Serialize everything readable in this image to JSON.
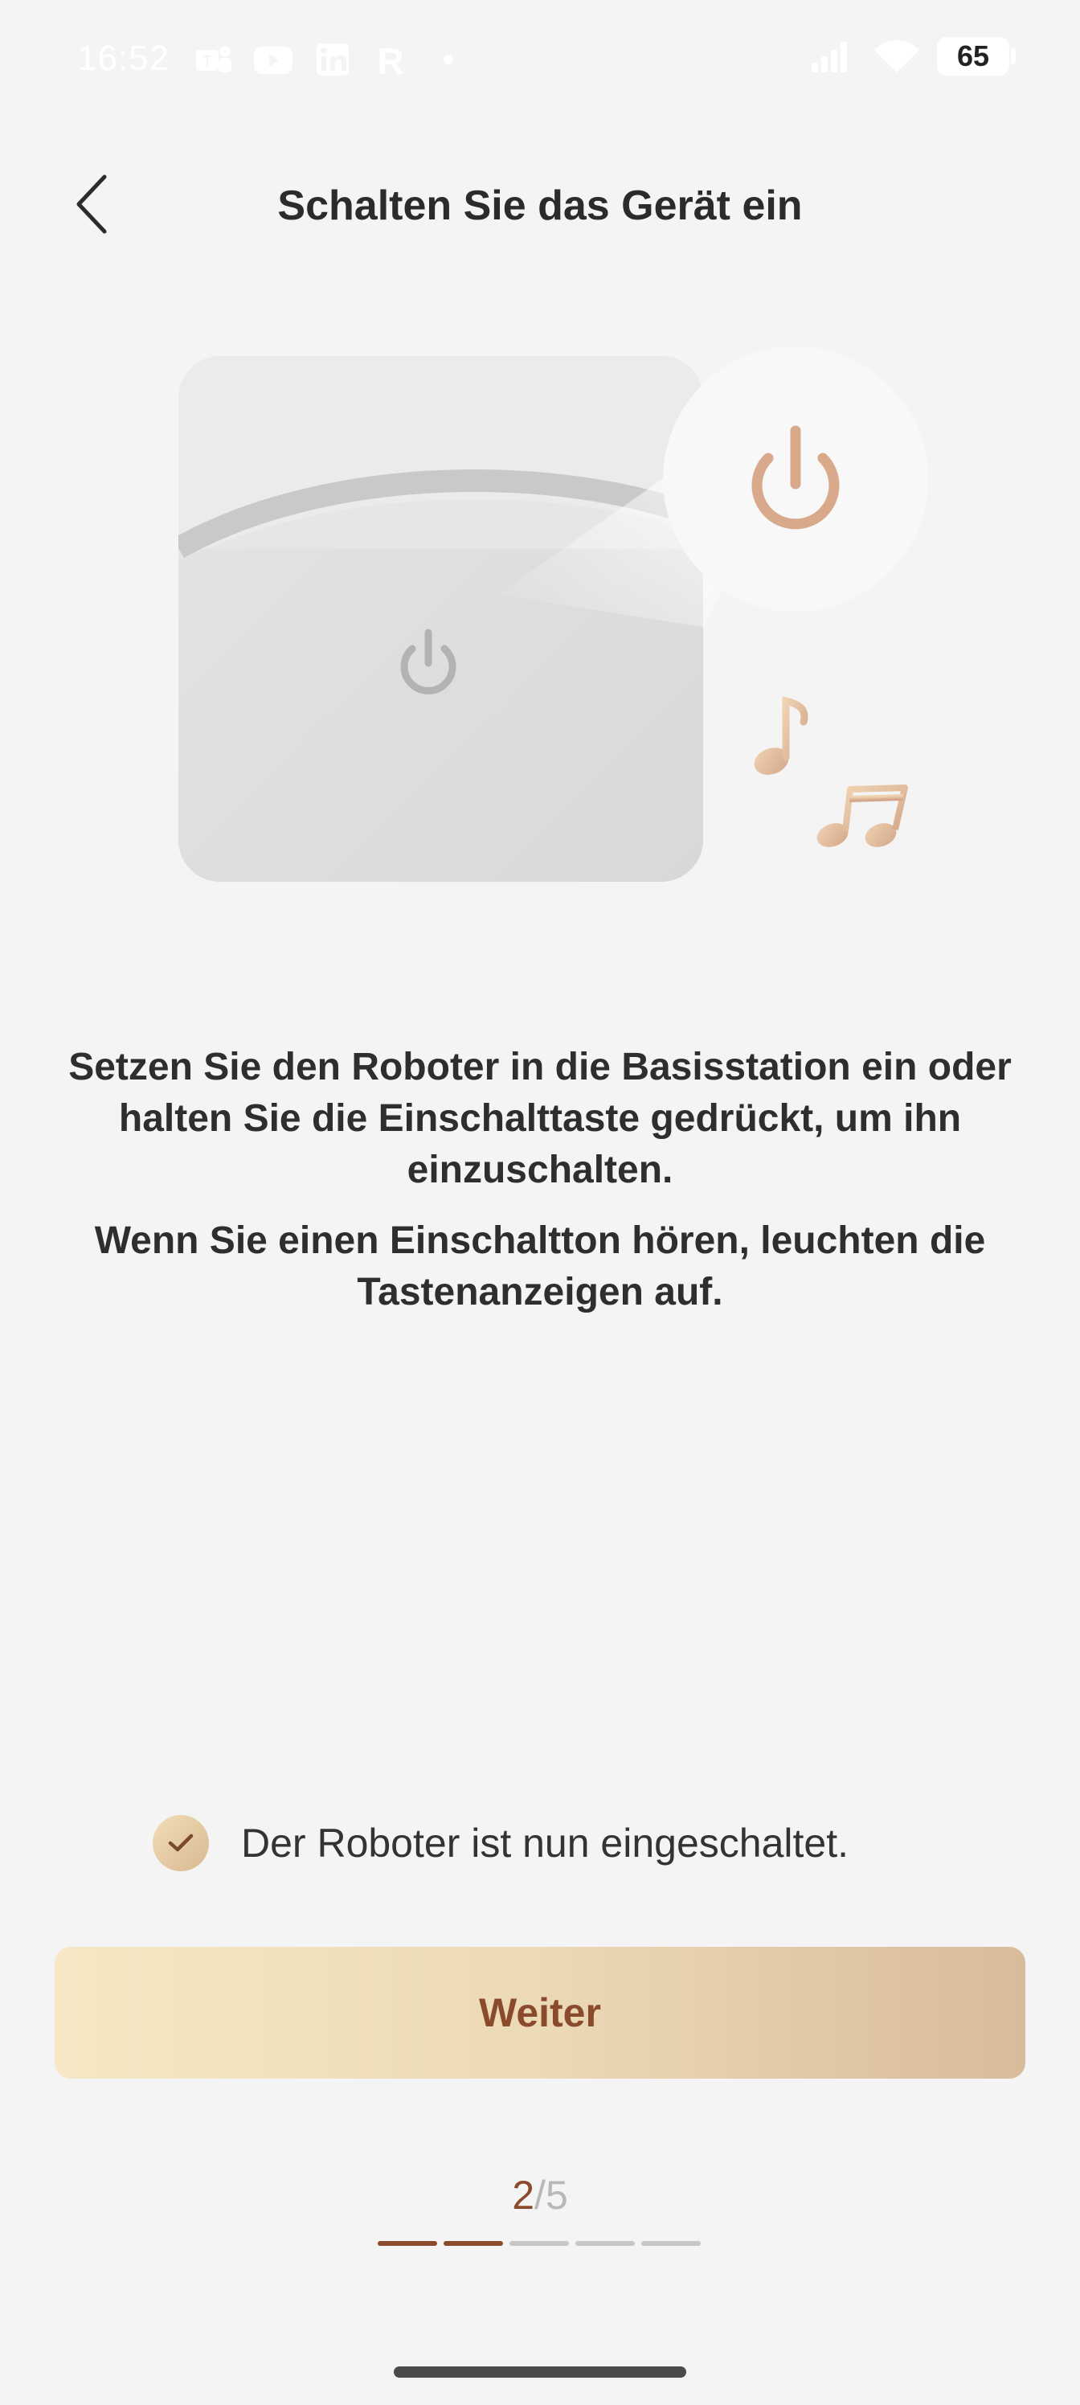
{
  "status_bar": {
    "time": "16:52",
    "left_icons": [
      "teams-icon",
      "youtube-icon",
      "linkedin-icon",
      "r-app-icon"
    ],
    "battery_level": "65",
    "right_icons": [
      "signal-icon",
      "wifi-icon",
      "battery-icon"
    ]
  },
  "header": {
    "title": "Schalten Sie das Gerät ein",
    "back_icon": "chevron-left-icon"
  },
  "illustration": {
    "device_power_icon": "power-icon",
    "highlight_power_icon": "power-icon",
    "music_icons": [
      "music-note-icon",
      "music-notes-icon"
    ],
    "accent_color": "#d9a98c"
  },
  "instructions": {
    "paragraph_1": "Setzen Sie den Roboter in die Basisstation ein oder halten Sie die Einschalttaste gedrückt, um ihn einzuschalten.",
    "paragraph_2": "Wenn Sie einen Einschaltton hören, leuchten die Tastenanzeigen auf."
  },
  "confirm": {
    "checked": true,
    "label": "Der Roboter ist nun eingeschaltet."
  },
  "next_button": {
    "label": "Weiter",
    "text_color": "#8a4b2c"
  },
  "progress": {
    "current": "2",
    "separator": "/",
    "total": "5",
    "steps_total": 5,
    "steps_done": 2,
    "active_color": "#8a4b2c"
  }
}
